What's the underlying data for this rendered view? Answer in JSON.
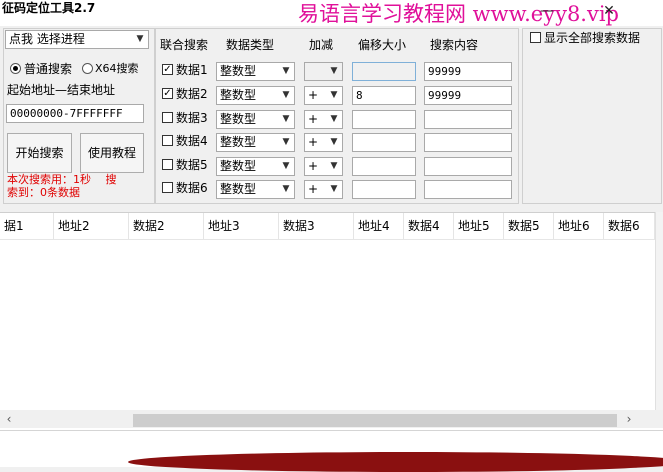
{
  "window": {
    "title": "征码定位工具2.7",
    "watermark": "易语言学习教程网 www.eyy8.vip",
    "minimize_glyph": "—",
    "close_glyph": "✕"
  },
  "left_panel": {
    "process_select": "点我 选择进程",
    "radio_normal": "普通搜索",
    "radio_x64": "X64搜索",
    "address_label": "起始地址—结束地址",
    "address_value": "00000000-7FFFFFFF",
    "start_button": "开始搜索",
    "tutorial_button": "使用教程",
    "status_line1": "本次搜索用：1秒　 搜",
    "status_line2": "索到：0条数据"
  },
  "search_table": {
    "headers": {
      "joint": "联合搜索",
      "type": "数据类型",
      "op": "加减",
      "offset": "偏移大小",
      "content": "搜索内容"
    },
    "rows": [
      {
        "checked": true,
        "check_mark": "✓",
        "label": "数据1",
        "type": "整数型",
        "op": "",
        "offset": "",
        "content": "99999"
      },
      {
        "checked": true,
        "check_mark": "✓",
        "label": "数据2",
        "type": "整数型",
        "op": "+",
        "offset": "8",
        "content": "99999"
      },
      {
        "checked": false,
        "check_mark": "",
        "label": "数据3",
        "type": "整数型",
        "op": "+",
        "offset": "",
        "content": ""
      },
      {
        "checked": false,
        "check_mark": "",
        "label": "数据4",
        "type": "整数型",
        "op": "+",
        "offset": "",
        "content": ""
      },
      {
        "checked": false,
        "check_mark": "",
        "label": "数据5",
        "type": "整数型",
        "op": "+",
        "offset": "",
        "content": ""
      },
      {
        "checked": false,
        "check_mark": "",
        "label": "数据6",
        "type": "整数型",
        "op": "+",
        "offset": "",
        "content": ""
      }
    ]
  },
  "right_panel": {
    "show_all_label": "显示全部搜索数据"
  },
  "results_grid": {
    "columns": [
      "据1",
      "地址2",
      "数据2",
      "地址3",
      "数据3",
      "地址4",
      "数据4",
      "地址5",
      "数据5",
      "地址6",
      "数据6"
    ]
  },
  "scroll": {
    "left_arrow": "‹",
    "right_arrow": "›"
  }
}
